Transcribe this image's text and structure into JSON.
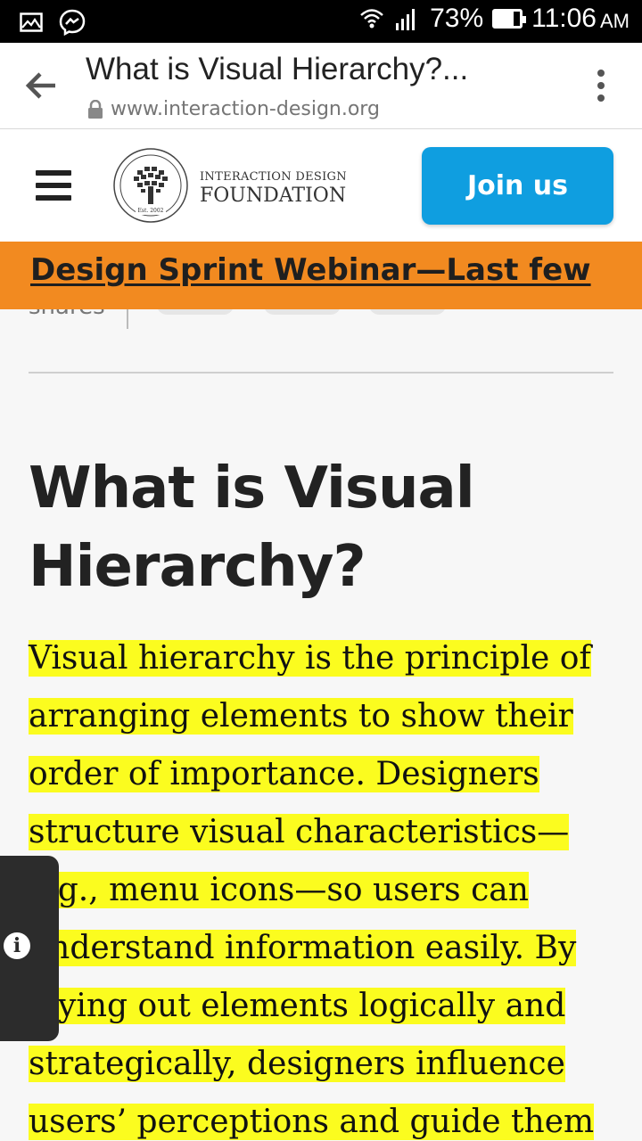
{
  "status_bar": {
    "battery_percent": "73%",
    "battery_level": 0.73,
    "time": "11:06",
    "ampm": "AM",
    "icons": [
      "image-icon",
      "messenger-icon",
      "wifi-icon",
      "signal-icon",
      "battery-icon"
    ]
  },
  "browser": {
    "page_title": "What is Visual Hierarchy?...",
    "url": "www.interaction-design.org"
  },
  "site_header": {
    "logo_line1": "INTERACTION DESIGN",
    "logo_line2": "FOUNDATION",
    "logo_est": "Est. 2002",
    "join_label": "Join us"
  },
  "banner": {
    "text": "Design Sprint Webinar—Last few",
    "background": "#f28a20"
  },
  "share": {
    "label": "shares"
  },
  "article": {
    "title_lines": [
      "What is Visual",
      "Hierarchy?"
    ],
    "body_lines": [
      "Visual hierarchy is the principle of",
      "arranging elements to show their",
      "order of importance. Designers",
      "structure visual characteristics—",
      "e.g., menu icons—so users can",
      "understand information easily. By",
      "laying out elements logically and",
      "strategically, designers influence",
      "users’ perceptions and guide them"
    ],
    "highlight_color": "#fbfc1f"
  },
  "accent_color": "#0f9ee0"
}
